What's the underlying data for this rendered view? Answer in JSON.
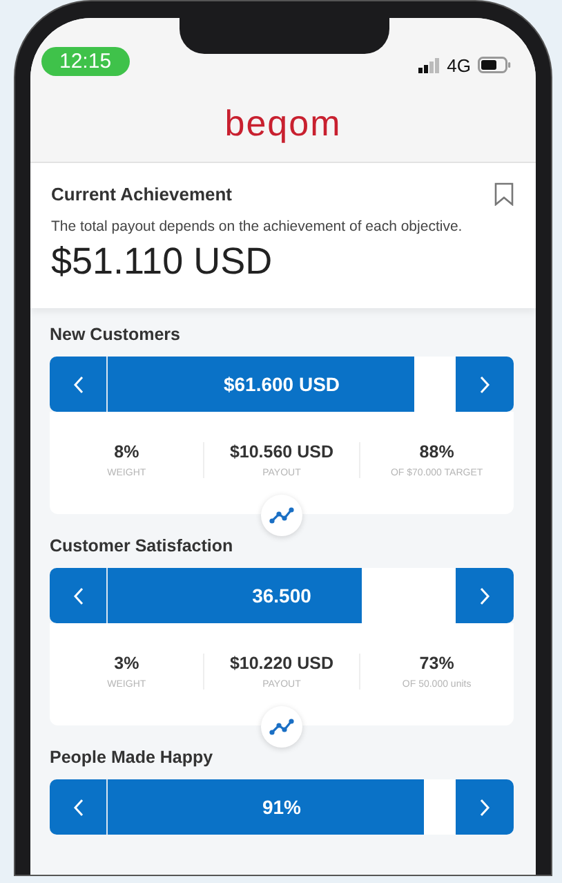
{
  "status_bar": {
    "time": "12:15",
    "network": "4G"
  },
  "header": {
    "logo": "beqom"
  },
  "summary": {
    "title": "Current Achievement",
    "description": "The total payout depends on the achievement of each objective.",
    "amount": "$51.110 USD"
  },
  "objectives": [
    {
      "title": "New Customers",
      "value": "$61.600 USD",
      "level": 0.88,
      "stats": [
        {
          "value": "8%",
          "label": "WEIGHT"
        },
        {
          "value": "$10.560 USD",
          "label": "PAYOUT"
        },
        {
          "value": "88%",
          "label": "OF $70.000 TARGET"
        }
      ]
    },
    {
      "title": "Customer Satisfaction",
      "value": "36.500",
      "level": 0.73,
      "stats": [
        {
          "value": "3%",
          "label": "WEIGHT"
        },
        {
          "value": "$10.220 USD",
          "label": "PAYOUT"
        },
        {
          "value": "73%",
          "label": "OF 50.000 units"
        }
      ]
    },
    {
      "title": "People Made Happy",
      "value": "91%",
      "level": 0.91
    }
  ]
}
